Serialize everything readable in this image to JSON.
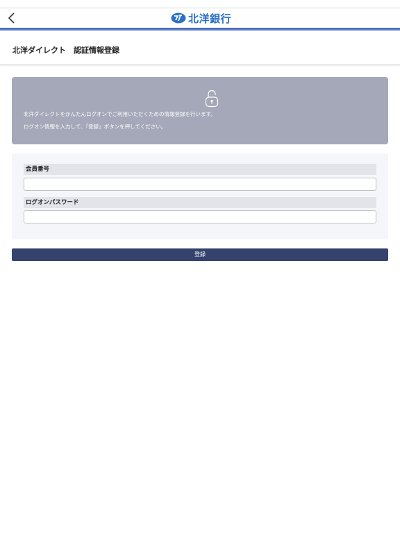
{
  "app": {
    "brand": "北洋銀行"
  },
  "header": {
    "title": "北洋ダイレクト　認証情報登録"
  },
  "info": {
    "line1": "北洋ダイレクトをかんたんログオンでご利用いただくための情報登録を行います。",
    "line2": "ログオン情報を入力して、『登録』ボタンを押してください。"
  },
  "form": {
    "member_label": "会員番号",
    "member_value": "",
    "password_label": "ログオンパスワード",
    "password_value": ""
  },
  "actions": {
    "submit_label": "登録"
  },
  "colors": {
    "accent": "#3a5fb8",
    "brand": "#2a6fc9",
    "info_bg": "#a4a8b8",
    "button_bg": "#34426d"
  },
  "icons": {
    "back": "chevron-left-icon",
    "logo": "hokuyo-logo-icon",
    "lock": "unlock-icon"
  }
}
